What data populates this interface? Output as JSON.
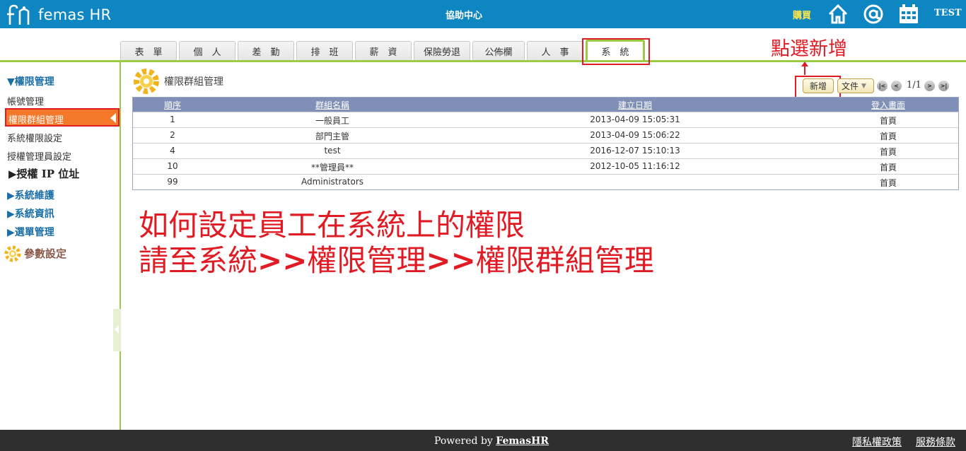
{
  "header": {
    "logo_text": "femas HR",
    "help_center": "協助中心",
    "buy": "購買",
    "user": "TEST",
    "icons": [
      "home-icon",
      "at-icon",
      "calendar-icon"
    ]
  },
  "tabs": [
    {
      "label": "表　單"
    },
    {
      "label": "個　人"
    },
    {
      "label": "差　勤"
    },
    {
      "label": "排　班"
    },
    {
      "label": "薪　資"
    },
    {
      "label": "保險勞退"
    },
    {
      "label": "公佈欄"
    },
    {
      "label": "人　事"
    },
    {
      "label": "系　統",
      "active": true
    }
  ],
  "annotation_add": "點選新增",
  "sidebar": {
    "section_permission": "▼權限管理",
    "item_account": "帳號管理",
    "item_group": "權限群組管理",
    "item_sys_perm": "系統權限設定",
    "item_admin": "授權管理員設定",
    "item_ip": "▶授權 IP 位址",
    "section_maintain": "▶系統維護",
    "section_info": "▶系統資訊",
    "section_menu": "▶選單管理",
    "section_params": "參數設定"
  },
  "main": {
    "title": "權限群組管理",
    "add_button": "新增",
    "doc_button": "文件",
    "pager": "1/1",
    "columns": [
      "順序",
      "群組名稱",
      "建立日期",
      "登入畫面"
    ],
    "rows": [
      {
        "seq": "1",
        "name": "一般員工",
        "date": "2013-04-09 15:05:31",
        "login": "首頁"
      },
      {
        "seq": "2",
        "name": "部門主管",
        "date": "2013-04-09 15:06:22",
        "login": "首頁"
      },
      {
        "seq": "4",
        "name": "test",
        "date": "2016-12-07 15:10:13",
        "login": "首頁"
      },
      {
        "seq": "10",
        "name": "**管理員**",
        "date": "2012-10-05 11:16:12",
        "login": "首頁"
      },
      {
        "seq": "99",
        "name": "Administrators",
        "date": "",
        "login": "首頁"
      }
    ]
  },
  "annotation": {
    "line1": "如何設定員工在系統上的權限",
    "line2_a": "請至系統",
    "line2_sep1": ">>",
    "line2_b": "權限管理",
    "line2_sep2": ">>",
    "line2_c": "權限群組管理"
  },
  "footer": {
    "powered_prefix": "Powered by ",
    "powered_link": "FemasHR",
    "privacy": "隱私權政策",
    "terms": "服務條款"
  },
  "colors": {
    "topbar": "#0e86c2",
    "accent_green": "#9ccc46",
    "active_orange": "#f4792a",
    "annotation_red": "#e01b24",
    "grid_header": "#7f8fb8"
  }
}
